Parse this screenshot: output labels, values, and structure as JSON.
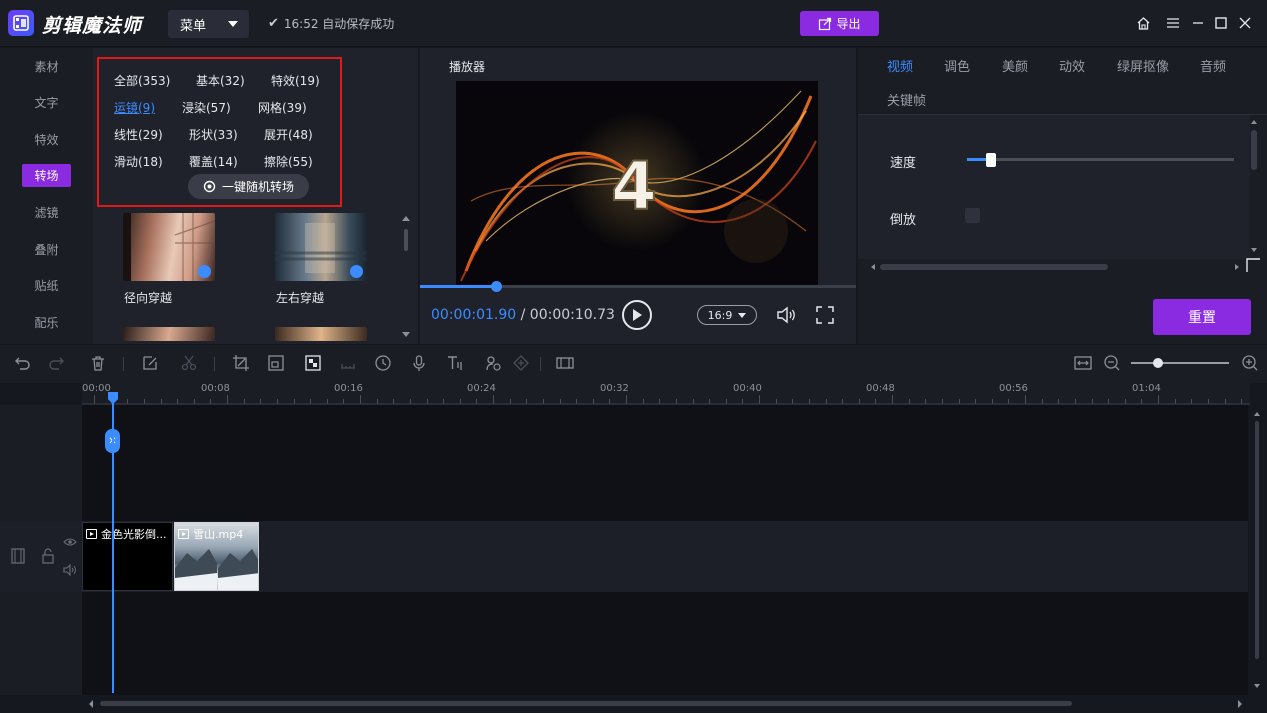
{
  "header": {
    "app_name": "剪辑魔法师",
    "menu_label": "菜单",
    "save_status": "16:52 自动保存成功",
    "export_label": "导出"
  },
  "left_nav": {
    "items": [
      {
        "label": "素材",
        "active": false
      },
      {
        "label": "文字",
        "active": false
      },
      {
        "label": "特效",
        "active": false
      },
      {
        "label": "转场",
        "active": true
      },
      {
        "label": "滤镜",
        "active": false
      },
      {
        "label": "叠附",
        "active": false
      },
      {
        "label": "贴纸",
        "active": false
      },
      {
        "label": "配乐",
        "active": false
      }
    ]
  },
  "transitions": {
    "categories": [
      {
        "label": "全部(353)"
      },
      {
        "label": "基本(32)"
      },
      {
        "label": "特效(19)"
      },
      {
        "label": "运镜(9)",
        "selected": true
      },
      {
        "label": "浸染(57)"
      },
      {
        "label": "网格(39)"
      },
      {
        "label": "线性(29)"
      },
      {
        "label": "形状(33)"
      },
      {
        "label": "展开(48)"
      },
      {
        "label": "滑动(18)"
      },
      {
        "label": "覆盖(14)"
      },
      {
        "label": "擦除(55)"
      }
    ],
    "random_button": "一键随机转场",
    "thumbnails": [
      {
        "label": "径向穿越"
      },
      {
        "label": "左右穿越"
      }
    ]
  },
  "player": {
    "title": "播放器",
    "current_time": "00:00:01.90",
    "total_time": "00:00:10.73",
    "time_separator": " / ",
    "aspect_ratio": "16:9",
    "video_overlay_text": "4",
    "progress_fraction": 0.177
  },
  "right_panel": {
    "tabs": [
      {
        "label": "视频",
        "active": true
      },
      {
        "label": "调色",
        "active": false
      },
      {
        "label": "美颜",
        "active": false
      },
      {
        "label": "动效",
        "active": false
      },
      {
        "label": "绿屏抠像",
        "active": false
      },
      {
        "label": "音频",
        "active": false
      },
      {
        "label": "关键帧",
        "active": false
      }
    ],
    "speed_label": "速度",
    "speed_fraction": 0.09,
    "reverse_label": "倒放",
    "reverse_checked": false,
    "reset_label": "重置"
  },
  "timeline": {
    "ruler_ticks": [
      "00:00",
      "00:08",
      "00:16",
      "00:24",
      "00:32",
      "00:40",
      "00:48",
      "00:56",
      "01:04"
    ],
    "clips": [
      {
        "label": "金色光影倒..."
      },
      {
        "label": "雪山.mp4"
      }
    ],
    "zoom_fraction": 0.28
  },
  "colors": {
    "accent_purple": "#8a2be2",
    "accent_blue": "#3b8cff",
    "highlight_red": "#e01919",
    "bg_dark": "#16181f"
  }
}
